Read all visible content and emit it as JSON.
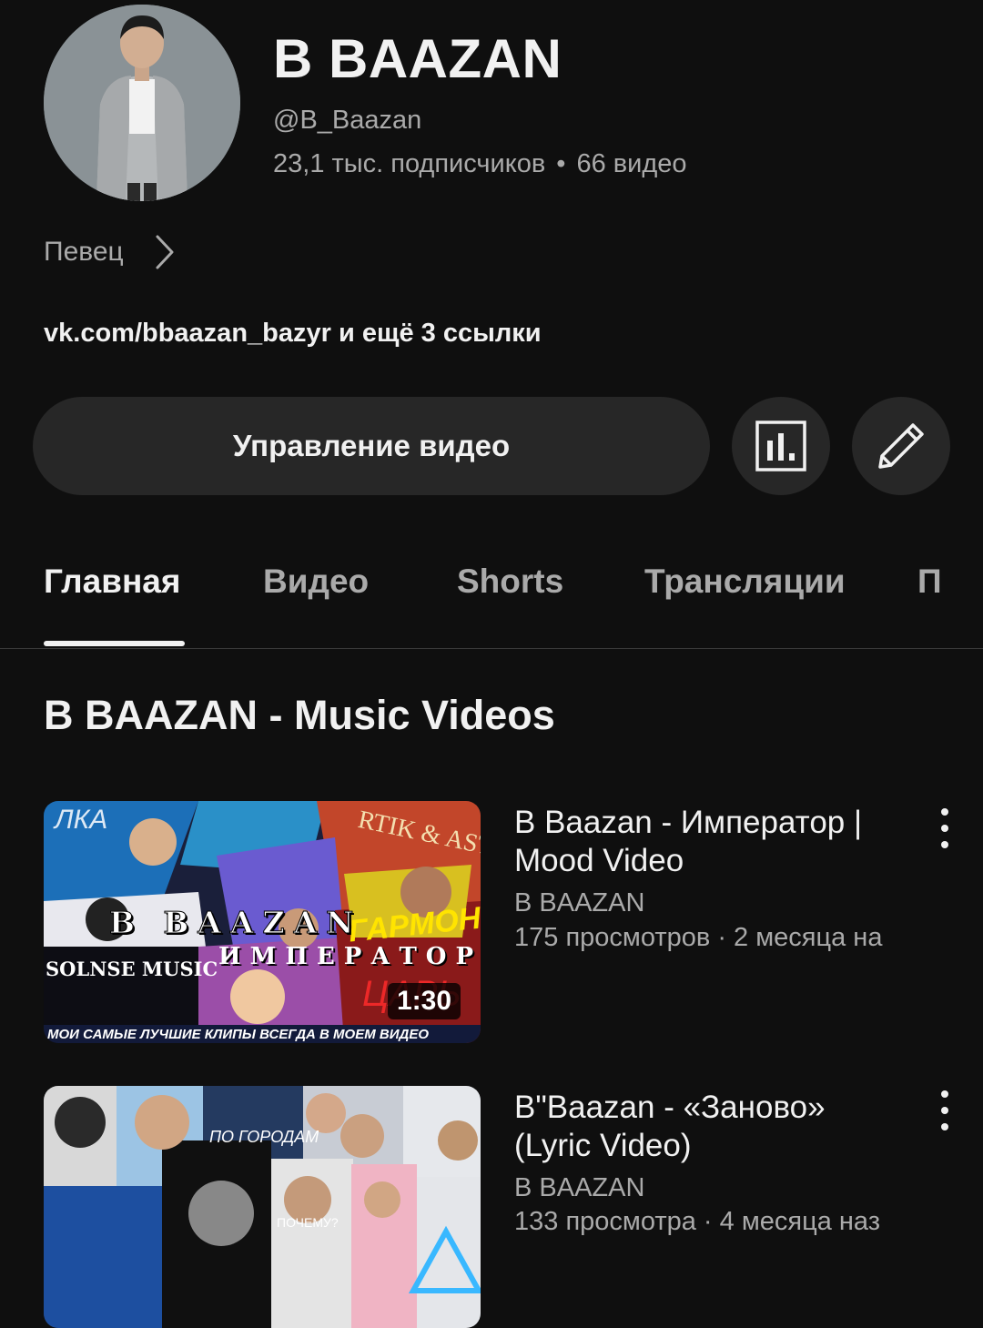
{
  "channel": {
    "name": "B BAAZAN",
    "handle": "@B_Baazan",
    "subscribers": "23,1 тыс. подписчиков",
    "videos_count": "66 видео",
    "category": "Певец",
    "links": "vk.com/bbaazan_bazyr и ещё 3 ссылки"
  },
  "actions": {
    "manage_videos": "Управление видео",
    "analytics_icon": "analytics-icon",
    "edit_icon": "pencil-icon"
  },
  "tabs": [
    {
      "label": "Главная",
      "active": true
    },
    {
      "label": "Видео",
      "active": false
    },
    {
      "label": "Shorts",
      "active": false
    },
    {
      "label": "Трансляции",
      "active": false
    },
    {
      "label": "П",
      "active": false
    }
  ],
  "section": {
    "title": "B BAAZAN - Music Videos"
  },
  "videos": [
    {
      "title": "B Baazan - Император | Mood Video",
      "channel": "B BAAZAN",
      "meta": "175 просмотров · 2 месяца на",
      "duration": "1:30",
      "thumb_text": {
        "brand": "B BAAZAN",
        "subtitle": "ИМПЕРАТОР",
        "label": "SOLNSE MUSIC",
        "footer": "МОИ САМЫЕ ЛУЧШИЕ КЛИПЫ ВСЕГДА В МОЕМ ВИДЕО"
      }
    },
    {
      "title": "B\"Baazan - «Заново» (Lyric Video)",
      "channel": "B BAAZAN",
      "meta": "133 просмотра · 4 месяца наз",
      "thumb_text": {
        "overlay1": "ПО ГОРОДАМ",
        "overlay2": "ПОЧЕМУ?"
      }
    }
  ]
}
